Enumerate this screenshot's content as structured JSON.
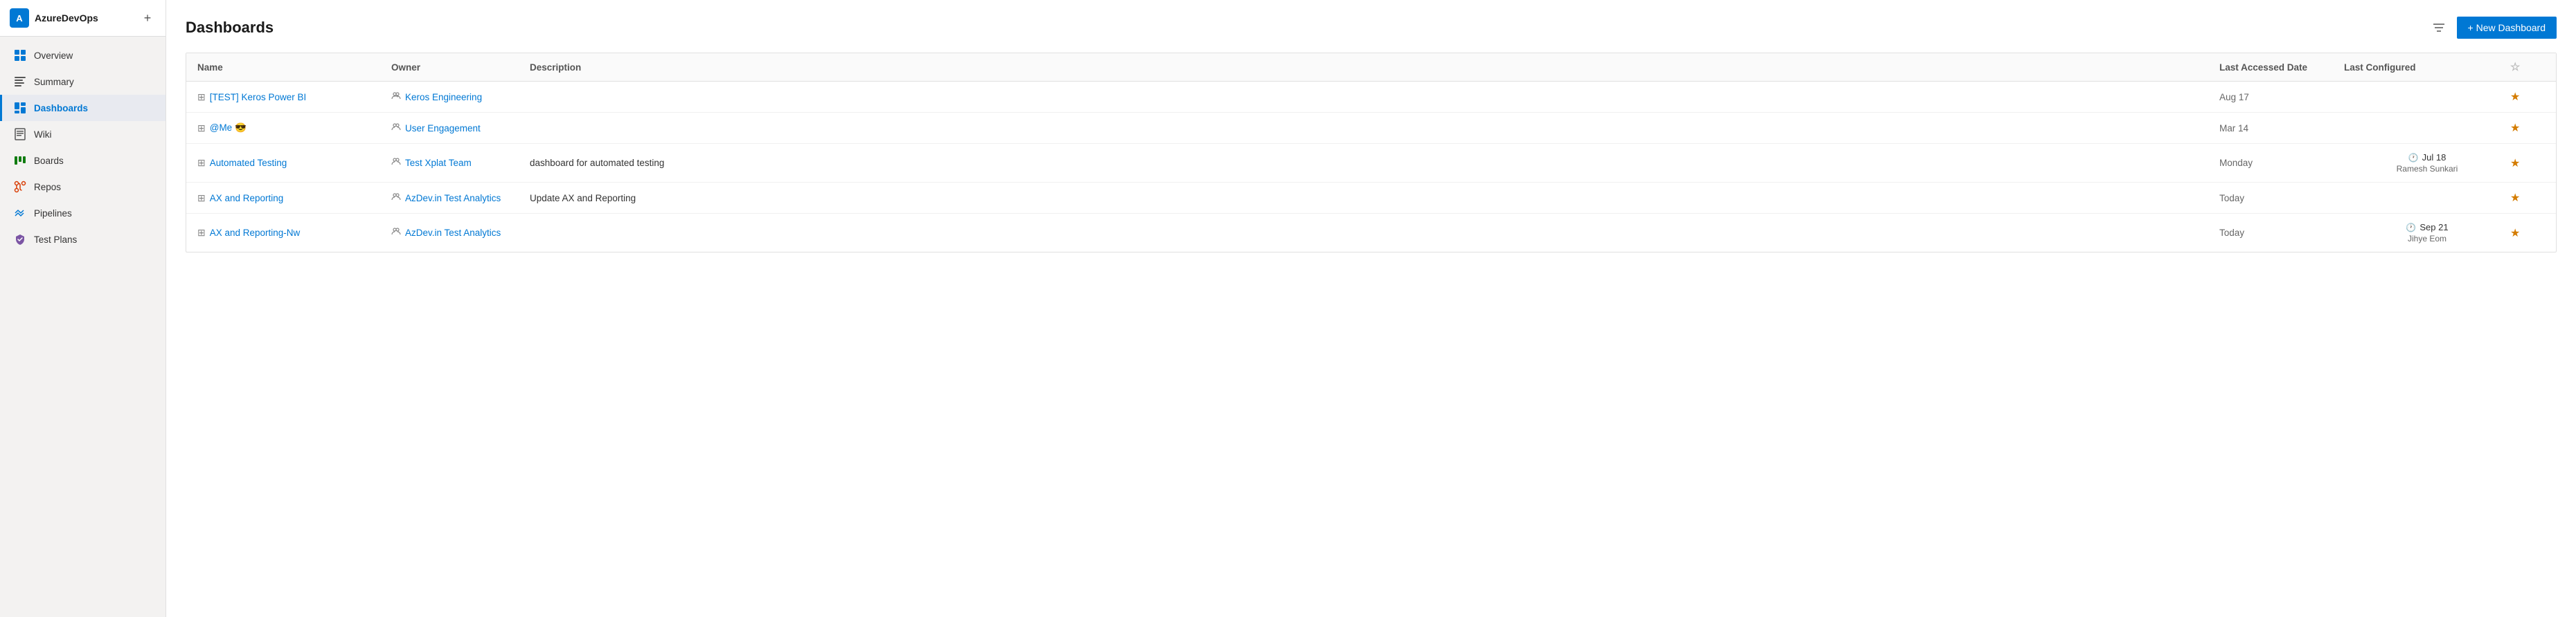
{
  "sidebar": {
    "org_icon_text": "A",
    "org_name": "AzureDevOps",
    "add_label": "+",
    "nav_items": [
      {
        "id": "overview",
        "label": "Overview",
        "icon": "overview",
        "active": false
      },
      {
        "id": "summary",
        "label": "Summary",
        "icon": "summary",
        "active": false
      },
      {
        "id": "dashboards",
        "label": "Dashboards",
        "icon": "dashboards",
        "active": true
      },
      {
        "id": "wiki",
        "label": "Wiki",
        "icon": "wiki",
        "active": false
      },
      {
        "id": "boards",
        "label": "Boards",
        "icon": "boards",
        "active": false
      },
      {
        "id": "repos",
        "label": "Repos",
        "icon": "repos",
        "active": false
      },
      {
        "id": "pipelines",
        "label": "Pipelines",
        "icon": "pipelines",
        "active": false
      },
      {
        "id": "test-plans",
        "label": "Test Plans",
        "icon": "test-plans",
        "active": false
      }
    ]
  },
  "page": {
    "title": "Dashboards",
    "new_dashboard_label": "+ New Dashboard"
  },
  "table": {
    "columns": [
      "Name",
      "Owner",
      "Description",
      "Last Accessed Date",
      "Last Configured",
      ""
    ],
    "rows": [
      {
        "id": 1,
        "name": "[TEST] Keros Power BI",
        "owner": "Keros Engineering",
        "description": "",
        "last_accessed": "Aug 17",
        "last_configured_date": "",
        "last_configured_user": "",
        "starred": true
      },
      {
        "id": 2,
        "name": "@Me 😎",
        "owner": "User Engagement",
        "description": "",
        "last_accessed": "Mar 14",
        "last_configured_date": "",
        "last_configured_user": "",
        "starred": true
      },
      {
        "id": 3,
        "name": "Automated Testing",
        "owner": "Test Xplat Team",
        "description": "dashboard for automated testing",
        "last_accessed": "Monday",
        "last_configured_date": "Jul 18",
        "last_configured_user": "Ramesh Sunkari",
        "starred": true
      },
      {
        "id": 4,
        "name": "AX and Reporting",
        "owner": "AzDev.in Test Analytics",
        "description": "Update AX and Reporting",
        "last_accessed": "Today",
        "last_configured_date": "",
        "last_configured_user": "",
        "starred": true
      },
      {
        "id": 5,
        "name": "AX and Reporting-Nw",
        "owner": "AzDev.in Test Analytics",
        "description": "",
        "last_accessed": "Today",
        "last_configured_date": "Sep 21",
        "last_configured_user": "Jihye Eom",
        "starred": true
      }
    ]
  }
}
